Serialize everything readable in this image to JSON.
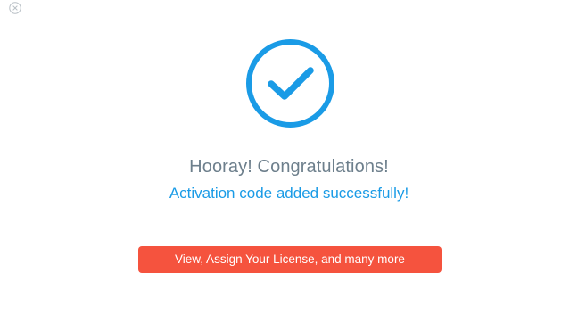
{
  "dialog": {
    "close_icon": "close-circle-icon",
    "success_icon": "check-circle-icon",
    "headline": "Hooray! Congratulations!",
    "subline": "Activation code added successfully!",
    "cta_label": "View, Assign Your License, and many more"
  },
  "colors": {
    "accent_blue": "#1a9be6",
    "headline_gray": "#6d7f8c",
    "cta_red": "#f5533e",
    "close_gray": "#b9c0c6"
  }
}
